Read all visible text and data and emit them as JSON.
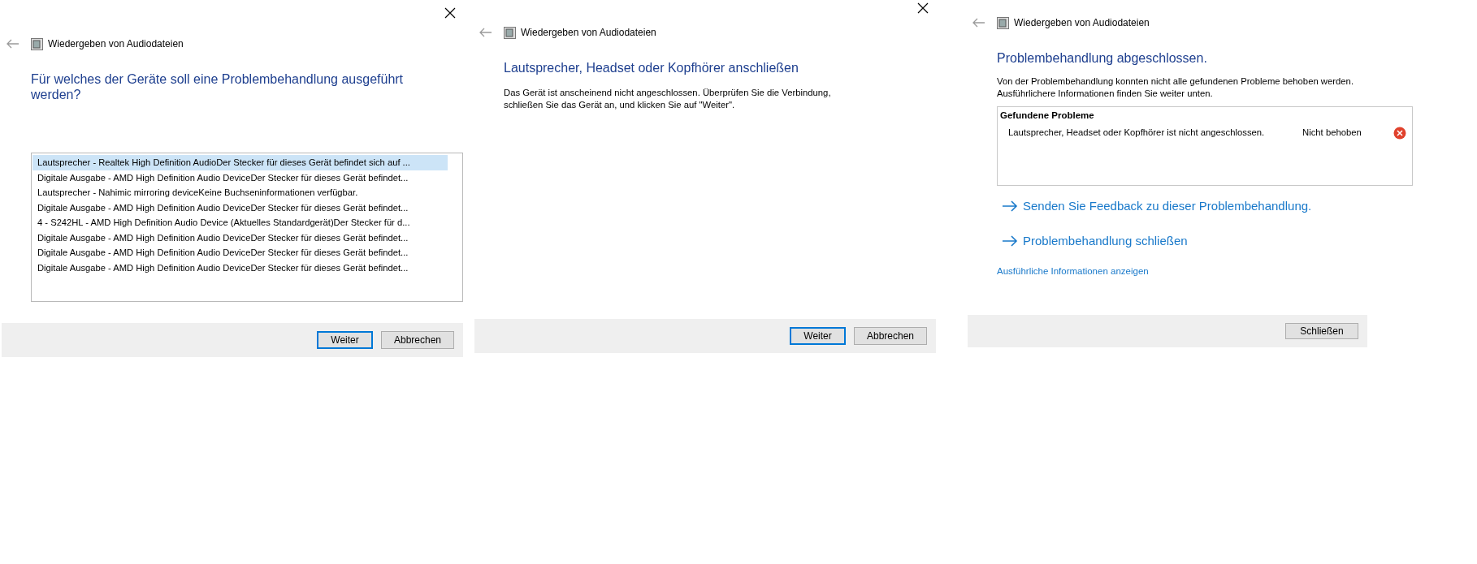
{
  "dialogs": [
    {
      "kind": "device_select",
      "title": "Wiedergeben von Audiodateien",
      "heading": "Für welches der Geräte soll eine Problembehandlung ausgeführt werden?",
      "devices": [
        {
          "label": "Lautsprecher - Realtek High Definition AudioDer Stecker für dieses Gerät befindet sich auf ...",
          "selected": true
        },
        {
          "label": "Digitale Ausgabe - AMD High Definition Audio DeviceDer Stecker für dieses Gerät befindet...",
          "selected": false
        },
        {
          "label": "Lautsprecher - Nahimic mirroring deviceKeine Buchseninformationen verfügbar.",
          "selected": false
        },
        {
          "label": "Digitale Ausgabe - AMD High Definition Audio DeviceDer Stecker für dieses Gerät befindet...",
          "selected": false
        },
        {
          "label": "4 - S242HL - AMD High Definition Audio Device (Aktuelles Standardgerät)Der Stecker für d...",
          "selected": false
        },
        {
          "label": "Digitale Ausgabe - AMD High Definition Audio DeviceDer Stecker für dieses Gerät befindet...",
          "selected": false
        },
        {
          "label": "Digitale Ausgabe - AMD High Definition Audio DeviceDer Stecker für dieses Gerät befindet...",
          "selected": false
        },
        {
          "label": "Digitale Ausgabe - AMD High Definition Audio DeviceDer Stecker für dieses Gerät befindet...",
          "selected": false
        }
      ],
      "buttons": [
        {
          "label": "Weiter",
          "default": true
        },
        {
          "label": "Abbrechen",
          "default": false
        }
      ]
    },
    {
      "kind": "message",
      "title": "Wiedergeben von Audiodateien",
      "heading": "Lautsprecher, Headset oder Kopfhörer anschließen",
      "body": "Das Gerät ist anscheinend nicht angeschlossen. Überprüfen Sie die Verbindung, schließen Sie das Gerät an, und klicken Sie auf \"Weiter\".",
      "buttons": [
        {
          "label": "Weiter",
          "default": true
        },
        {
          "label": "Abbrechen",
          "default": false
        }
      ]
    },
    {
      "kind": "result",
      "title": "Wiedergeben von Audiodateien",
      "heading": "Problembehandlung abgeschlossen.",
      "body": "Von der Problembehandlung konnten nicht alle gefundenen Probleme behoben werden. Ausführlichere Informationen finden Sie weiter unten.",
      "problems_title": "Gefundene Probleme",
      "problems": [
        {
          "description": "Lautsprecher, Headset oder Kopfhörer ist nicht angeschlossen.",
          "status": "Nicht behoben",
          "fixed": false
        }
      ],
      "actions": [
        "Senden Sie Feedback zu dieser Problembehandlung.",
        "Problembehandlung schließen"
      ],
      "details_link": "Ausführliche Informationen anzeigen",
      "buttons": [
        {
          "label": "Schließen",
          "default": false
        }
      ]
    }
  ]
}
